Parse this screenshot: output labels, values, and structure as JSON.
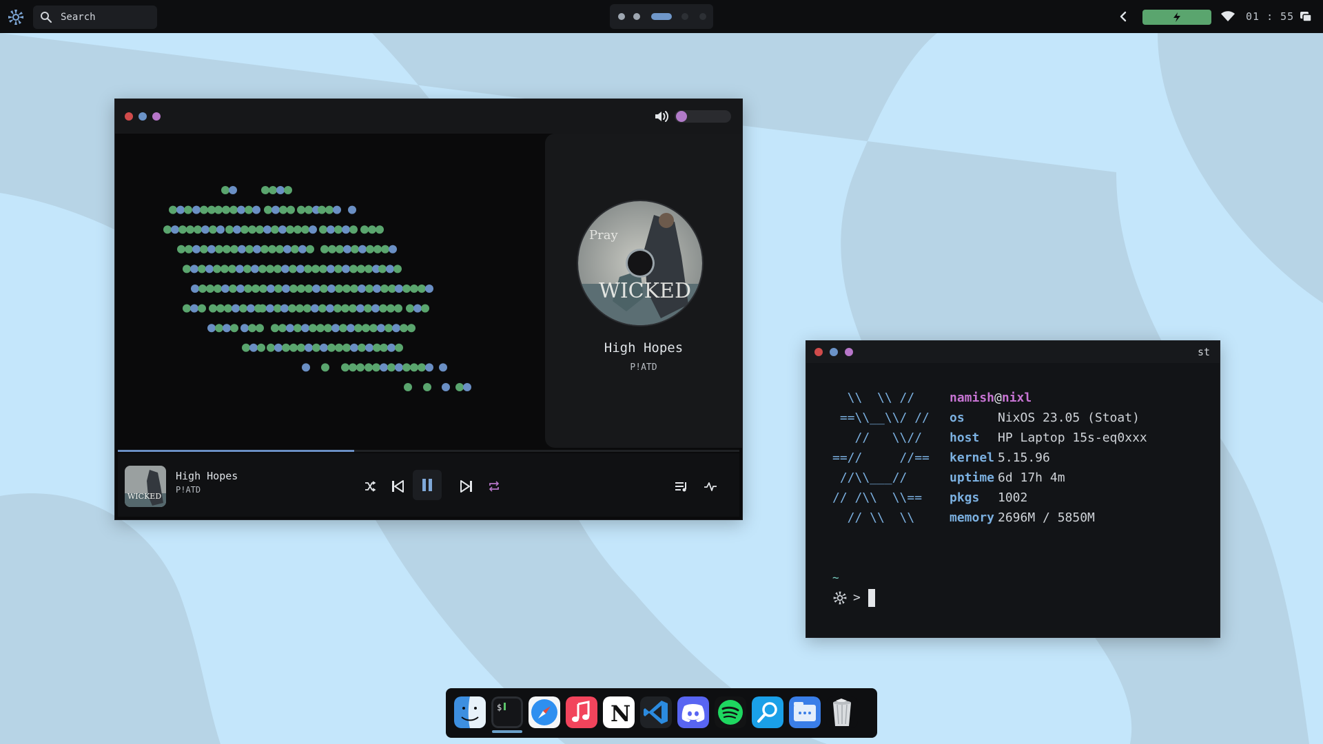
{
  "topbar": {
    "search_placeholder": "Search",
    "clock": "01 : 55",
    "workspaces": [
      {
        "state": "inactive"
      },
      {
        "state": "inactive"
      },
      {
        "state": "active"
      },
      {
        "state": "empty"
      },
      {
        "state": "empty"
      }
    ],
    "icons": [
      "nixos-logo-icon",
      "search-icon",
      "chevron-left-icon",
      "battery-charging-icon",
      "wifi-icon",
      "notification-icon"
    ]
  },
  "player": {
    "now_playing": {
      "title": "High Hopes",
      "artist": "P!ATD"
    },
    "progress": 0.38,
    "volume": 0.0,
    "controls": [
      "shuffle-icon",
      "previous-icon",
      "pause-icon",
      "next-icon",
      "repeat-icon",
      "queue-icon",
      "visualizer-icon"
    ]
  },
  "terminal": {
    "title": "st",
    "user": "namish",
    "at": "@",
    "host_name": "nixl",
    "ascii_art": [
      "  \\\\  \\\\ //",
      " ==\\\\__\\\\/ //",
      "   //   \\\\//",
      "==//     //==",
      " //\\\\___//",
      "// /\\\\  \\\\==",
      "  // \\\\  \\\\"
    ],
    "info": [
      {
        "key": "os",
        "value": "NixOS 23.05 (Stoat)"
      },
      {
        "key": "host",
        "value": "HP Laptop 15s-eq0xxx"
      },
      {
        "key": "kernel",
        "value": "5.15.96"
      },
      {
        "key": "uptime",
        "value": "6d 17h 4m"
      },
      {
        "key": "pkgs",
        "value": "1002"
      },
      {
        "key": "memory",
        "value": "2696M / 5850M"
      }
    ],
    "prompt_dir": "~",
    "prompt_symbol": ">"
  },
  "dock": {
    "apps": [
      "finder",
      "terminal",
      "safari",
      "music",
      "notion",
      "vscode",
      "discord",
      "spotify",
      "search",
      "files",
      "trash"
    ],
    "active": "terminal"
  },
  "colors": {
    "accent_purple": "#b27bc9",
    "accent_blue": "#6a8fc4",
    "accent_green": "#5aa56e",
    "close": "#d04b4b",
    "minimize": "#6b93c8",
    "maximize": "#b776c9"
  }
}
